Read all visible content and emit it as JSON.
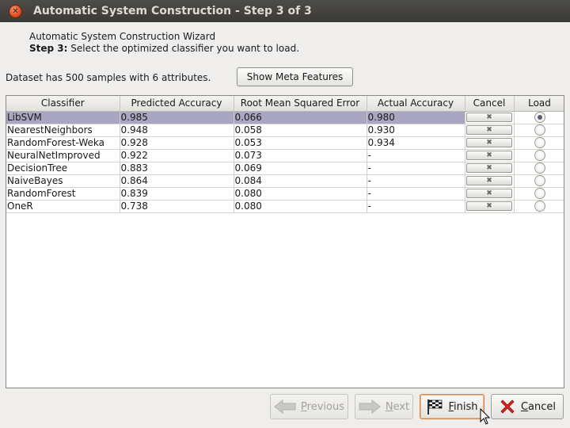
{
  "window": {
    "title": "Automatic System Construction - Step 3 of 3",
    "close_glyph": "✕"
  },
  "header": {
    "wizard_name": "Automatic System Construction Wizard",
    "step_label": "Step 3:",
    "step_text": " Select the optimized classifier you want to load."
  },
  "dataset": {
    "info": "Dataset has 500 samples with 6 attributes.",
    "meta_button": "Show Meta Features"
  },
  "table": {
    "columns": [
      "Classifier",
      "Predicted Accuracy",
      "Root Mean Squared Error",
      "Actual Accuracy",
      "Cancel",
      "Load"
    ],
    "cancel_glyph": "✖",
    "rows": [
      {
        "classifier": "LibSVM",
        "predicted": "0.985",
        "rmse": "0.066",
        "actual": "0.980",
        "selected": true
      },
      {
        "classifier": "NearestNeighbors",
        "predicted": "0.948",
        "rmse": "0.058",
        "actual": "0.930",
        "selected": false
      },
      {
        "classifier": "RandomForest-Weka",
        "predicted": "0.928",
        "rmse": "0.053",
        "actual": "0.934",
        "selected": false
      },
      {
        "classifier": "NeuralNetImproved",
        "predicted": "0.922",
        "rmse": "0.073",
        "actual": "-",
        "selected": false
      },
      {
        "classifier": "DecisionTree",
        "predicted": "0.883",
        "rmse": "0.069",
        "actual": "-",
        "selected": false
      },
      {
        "classifier": "NaiveBayes",
        "predicted": "0.864",
        "rmse": "0.084",
        "actual": "-",
        "selected": false
      },
      {
        "classifier": "RandomForest",
        "predicted": "0.839",
        "rmse": "0.080",
        "actual": "-",
        "selected": false
      },
      {
        "classifier": "OneR",
        "predicted": "0.738",
        "rmse": "0.080",
        "actual": "-",
        "selected": false
      }
    ]
  },
  "footer": {
    "previous": {
      "mnemonic": "P",
      "rest": "revious",
      "icon": "arrow-left-icon",
      "enabled": false
    },
    "next": {
      "mnemonic": "N",
      "rest": "ext",
      "icon": "arrow-right-icon",
      "enabled": false
    },
    "finish": {
      "mnemonic": "F",
      "rest": "inish",
      "icon": "checkered-flag-icon",
      "enabled": true
    },
    "cancel": {
      "mnemonic": "C",
      "rest": "ancel",
      "icon": "red-x-icon",
      "enabled": true
    }
  },
  "colors": {
    "titlebar": "#3b3a36",
    "selected_row": "#a9a6c2",
    "cancel_red": "#d8261e",
    "focus_orange": "#d48447"
  }
}
